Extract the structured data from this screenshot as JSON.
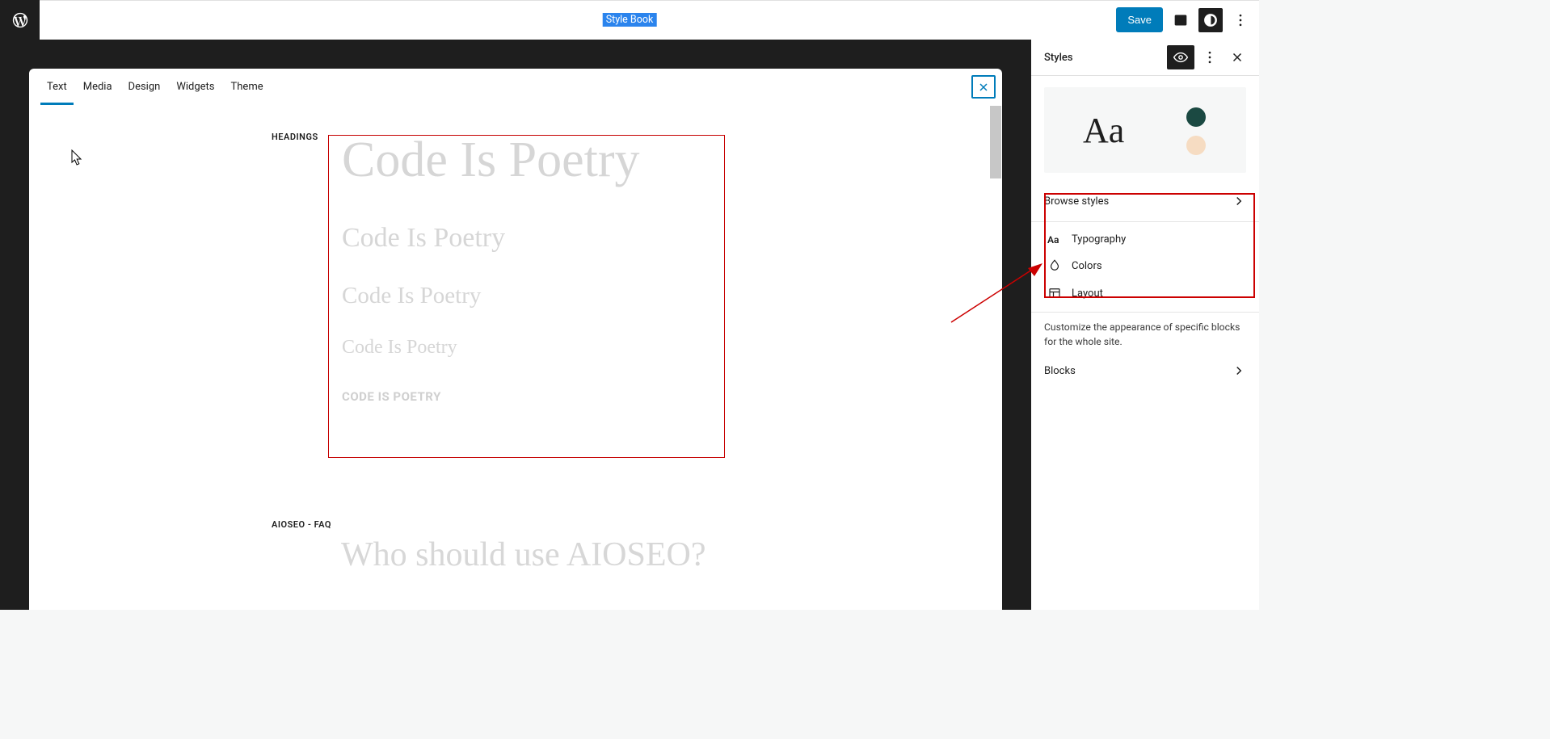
{
  "topbar": {
    "title": "Style Book",
    "save_label": "Save"
  },
  "canvas": {
    "tabs": [
      "Text",
      "Media",
      "Design",
      "Widgets",
      "Theme"
    ],
    "active_tab_index": 0,
    "sections": {
      "headings_label": "HEADINGS",
      "aioseo_label": "AIOSEO - FAQ"
    },
    "headings": {
      "h1": "Code Is Poetry",
      "h2": "Code Is Poetry",
      "h3": "Code Is Poetry",
      "h4": "Code Is Poetry",
      "h5": "CODE IS POETRY"
    },
    "faq_question": "Who should use AIOSEO?"
  },
  "sidebar": {
    "title": "Styles",
    "preview_glyph": "Aa",
    "swatches": {
      "primary": "#1b4942",
      "secondary": "#f6dcc2"
    },
    "browse_label": "Browse styles",
    "options": {
      "typography": "Typography",
      "colors": "Colors",
      "layout": "Layout"
    },
    "blocks_desc": "Customize the appearance of specific blocks for the whole site.",
    "blocks_label": "Blocks"
  }
}
